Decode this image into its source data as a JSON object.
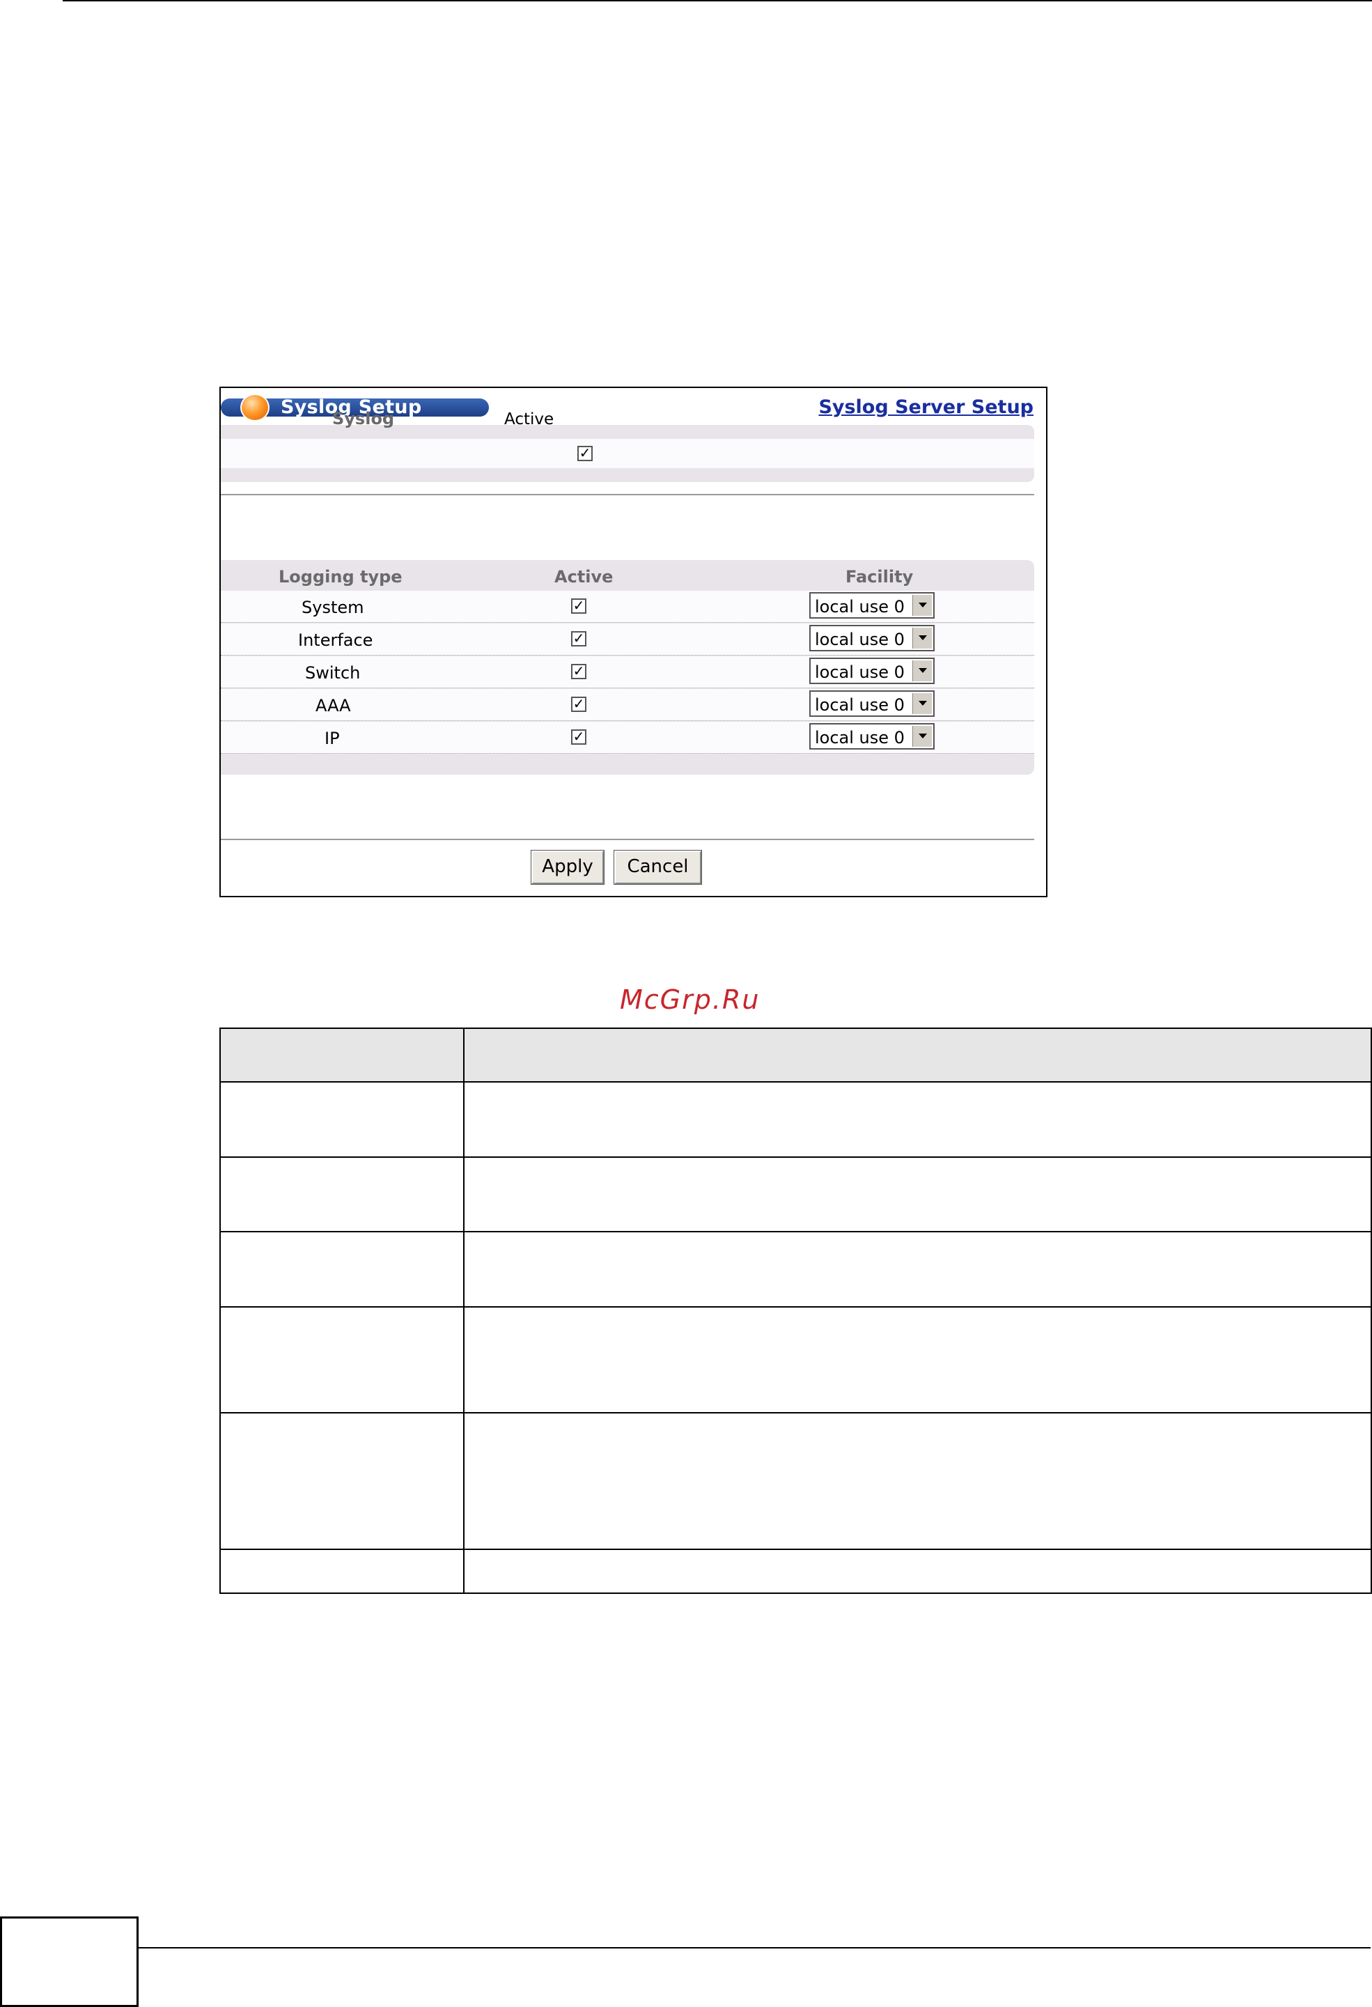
{
  "window": {
    "title": "Syslog Setup",
    "link": "Syslog Server Setup"
  },
  "syslog": {
    "label": "Syslog",
    "active_label": "Active",
    "active_checked": true
  },
  "logging_table": {
    "headers": [
      "Logging type",
      "Active",
      "Facility"
    ],
    "rows": [
      {
        "type": "System",
        "active": true,
        "facility": "local use 0"
      },
      {
        "type": "Interface",
        "active": true,
        "facility": "local use 0"
      },
      {
        "type": "Switch",
        "active": true,
        "facility": "local use 0"
      },
      {
        "type": "AAA",
        "active": true,
        "facility": "local use 0"
      },
      {
        "type": "IP",
        "active": true,
        "facility": "local use 0"
      }
    ]
  },
  "buttons": {
    "apply": "Apply",
    "cancel": "Cancel"
  },
  "icons": {
    "title_orb": "orange-orb-icon",
    "checkbox": "check-icon",
    "dropdown": "chevron-down-icon"
  },
  "colors": {
    "title_bar": "#2a52a0",
    "link": "#1a2ea0",
    "panel_bg": "#e8e4ea",
    "watermark": "#c8252c"
  },
  "watermark": "McGrp.Ru"
}
